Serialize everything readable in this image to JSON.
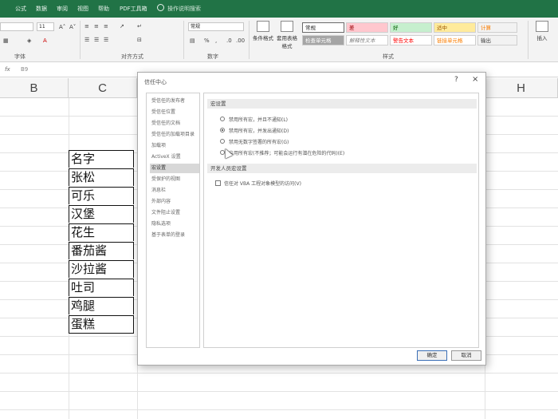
{
  "colors": {
    "accent": "#217346",
    "ribbon_bg": "#f3f3f3",
    "style_bad": "#ffc7ce",
    "style_good": "#c6efce",
    "style_neutral": "#ffeb9c"
  },
  "tabs": [
    "公式",
    "数据",
    "审阅",
    "视图",
    "帮助",
    "PDF工具箱",
    "操作说明搜索"
  ],
  "ribbon": {
    "font_size": "11",
    "number_format": "常规",
    "group_labels": [
      "字体",
      "对齐方式",
      "数字",
      "样式"
    ],
    "conditional_format": "条件格式",
    "table_format": "套用表格格式",
    "cell_styles": [
      "常规",
      "差",
      "好",
      "适中",
      "计算",
      "检查单元格",
      "解释性文本",
      "警告文本",
      "链接单元格",
      "输出"
    ],
    "insert": "插入"
  },
  "formula_bar": {
    "fx": "fx",
    "cell_ref": "B9"
  },
  "sheet": {
    "columns": [
      "B",
      "C",
      "H"
    ],
    "cells": [
      "名字",
      "张松",
      "可乐",
      "汉堡",
      "花生",
      "番茄酱",
      "沙拉酱",
      "吐司",
      "鸡腿",
      "蛋糕"
    ]
  },
  "dialog": {
    "title": "信任中心",
    "help": "?",
    "close": "×",
    "nav": [
      "受信任的发布者",
      "受信任位置",
      "受信任的文档",
      "受信任的加载项目录",
      "加载项",
      "ActiveX 设置",
      "宏设置",
      "受保护的视图",
      "消息栏",
      "外部内容",
      "文件阻止设置",
      "隐私选项",
      "基于表单的登录"
    ],
    "selected_nav_index": 6,
    "macro_section": "宏设置",
    "macro_options": [
      "禁用所有宏，并且不通知(L)",
      "禁用所有宏，并发出通知(D)",
      "禁用无数字签署的所有宏(G)",
      "启用所有宏(不推荐；可能会运行有潜在危险的代码)(E)"
    ],
    "selected_option_index": 1,
    "dev_section": "开发人员宏设置",
    "vba_trust": "信任对 VBA 工程对象模型的访问(V)",
    "ok": "确定",
    "cancel": "取消"
  }
}
